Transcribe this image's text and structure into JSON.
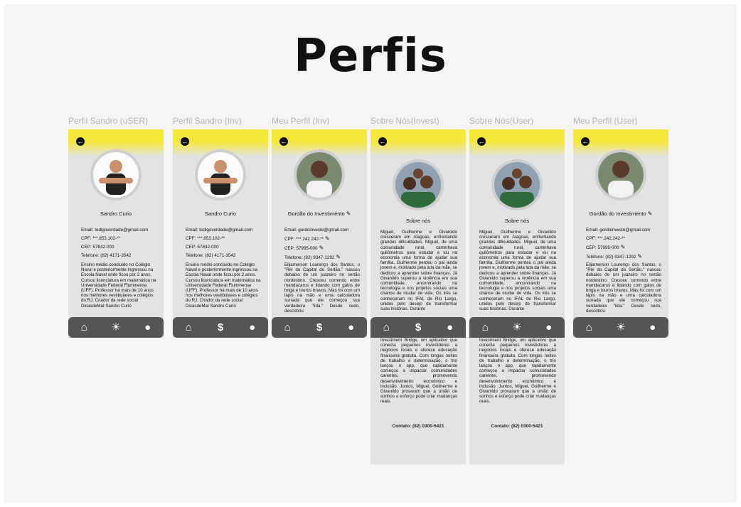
{
  "title": "Perfis",
  "frames": [
    {
      "label": "Perfil Sandro (uSER)",
      "name": "Sandro Curio",
      "email": "Email: tedigoverdade@gmail.com",
      "cpf": "CPF: ***.853.102-**",
      "cep": "CEP: 57842-000",
      "telefone": "Telefone: (82) 4171-3542",
      "bio": "Ensino médio concluído no Colégio Naval e posteriormente ingressou na Escola Naval onde ficou por 2 anos. Cursou licenciatura em matemática na Universidade Federal Fluminense (UFF). Professor há mais de 10 anos nos melhores vestibulares e colégios do RJ. Criador da rede social DicasdeMat Sandro Curió",
      "nav": [
        "home-icon",
        "lightbulb-icon",
        "chat-icon"
      ]
    },
    {
      "label": "Perfil Sandro (Inv)",
      "name": "Sandro Curio",
      "email": "Email: tedigoverdade@gmail.com",
      "cpf": "CPF: ***.853.102-**",
      "cep": "CEP: 57842-000",
      "telefone": "Telefone: (82) 4171-3542",
      "bio": "Ensino médio concluído no Colégio Naval e posteriormente ingressou na Escola Naval onde ficou por 2 anos. Cursou licenciatura em matemática na Universidade Federal Fluminense (UFF). Professor há mais de 10 anos nos melhores vestibulares e colégios do RJ. Criador da rede social DicasdeMat Sandro Curió",
      "nav": [
        "home-icon",
        "dollar-icon",
        "chat-icon"
      ]
    },
    {
      "label": "Meu Perfil (Inv)",
      "name": "Gordão do Investimento",
      "email": "Email: gordoinveste@gmail.com",
      "cpf": "CPF: ***.242.242-**",
      "cep": "CEP: 57995-000",
      "telefone": "Telefone: (82) 9347-1292",
      "bio": "Elijamerson Lourenço dos Santos, o \"Rei do Capital do Sertão,\" nasceu debaixo de um juazeiro no sertão nordestino. Cresceu correndo entre mandacarus e lidando com galos de briga e touros bravos. Mas foi com um lápis na mão e uma calculadora surrada que ele começou sua verdadeira \"lida.\" Desde cedo, descobriu",
      "nav": [
        "home-icon",
        "dollar-icon",
        "chat-icon"
      ]
    },
    {
      "label": "Sobre Nós(Invest)",
      "heading": "Sobre nós",
      "text_top": "Miguel, Guilherme e Givanildo cresceram em Alagoas, enfrentando grandes dificuldades. Miguel, de uma comunidade rural, caminhava quilômetros para estudar e viu na economia uma forma de ajudar sua família. Guilherme perdeu o pai ainda jovem e, motivado pela luta da mãe, se dedicou a aprender sobre finanças. Já Givanildo superou a violência em sua comunidade, encontrando na tecnologia e nos projetos sociais uma chance de mudar de vida. Os três se conheceram no IFAL de Rio Largo, unidos pelo desejo de transformar suas histórias. Durante",
      "text_bottom": "Investment Bridge, um aplicativo que conecta pequenos investidores a negócios locais e oferece educação financeira gratuita. Com longas noites de trabalho e determinação, o trio lançou o app, que rapidamente começou a impactar comunidades carentes, promovendo desenvolvimento econômico e inclusão. Juntos, Miguel, Guilherme e Givanildo provaram que a união de sonhos e esforço pode criar mudanças reais.",
      "contact": "Contato: (82) 0300-5421",
      "nav": [
        "home-icon",
        "dollar-icon",
        "chat-icon"
      ]
    },
    {
      "label": "Sobre Nós(User)",
      "heading": "Sobre nós",
      "text_top": "Miguel, Guilherme e Givanildo cresceram em Alagoas, enfrentando grandes dificuldades. Miguel, de uma comunidade rural, caminhava quilômetros para estudar e viu na economia uma forma de ajudar sua família. Guilherme perdeu o pai ainda jovem e, motivado pela luta da mãe, se dedicou a aprender sobre finanças. Já Givanildo superou a violência em sua comunidade, encontrando na tecnologia e nos projetos sociais uma chance de mudar de vida. Os três se conheceram no IFAL de Rio Largo, unidos pelo desejo de transformar suas histórias. Durante",
      "text_bottom": "Investment Bridge, um aplicativo que conecta pequenos investidores a negócios locais e oferece educação financeira gratuita. Com longas noites de trabalho e determinação, o trio lançou o app, que rapidamente começou a impactar comunidades carentes, promovendo desenvolvimento econômico e inclusão. Juntos, Miguel, Guilherme e Givanildo provaram que a união de sonhos e esforço pode criar mudanças reais.",
      "contact": "Contato: (82) 0300-5421",
      "nav": [
        "home-icon",
        "lightbulb-icon",
        "chat-icon"
      ]
    },
    {
      "label": "Meu Perfil (User)",
      "name": "Gordão do Investimento",
      "email": "Email: gordoinveste@gmail.com",
      "cpf": "CPF: ***.242.242-**",
      "cep": "CEP: 57995-000",
      "telefone": "Telefone: (82) 9347-1292",
      "bio": "Elijamerson Lourenço dos Santos, o \"Rei do Capital do Sertão,\" nasceu debaixo de um juazeiro no sertão nordestino. Cresceu correndo entre mandacarus e lidando com galos de briga e touros bravos. Mas foi com um lápis na mão e uma calculadora surrada que ele começou sua verdadeira \"lida.\" Desde cedo, descobriu",
      "nav": [
        "home-icon",
        "lightbulb-icon",
        "chat-icon"
      ]
    }
  ],
  "icons": {
    "pencil": "✎",
    "back": "←"
  },
  "colors": {
    "accent": "#f6e73a",
    "navbar": "#555555",
    "frame": "#e3e3e3"
  }
}
